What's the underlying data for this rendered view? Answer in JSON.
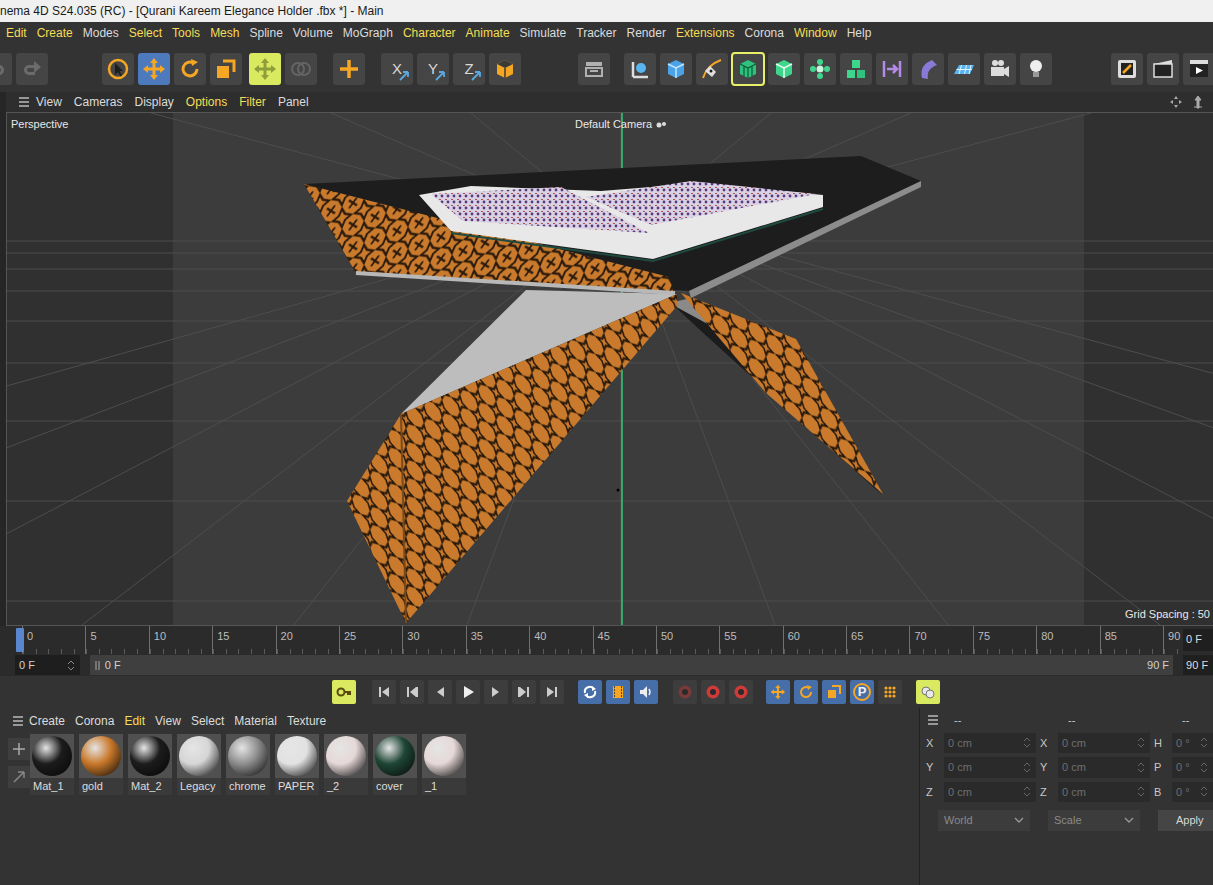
{
  "window": {
    "title": "nema 4D S24.035 (RC) - [Qurani Kareem Elegance Holder .fbx *] - Main"
  },
  "menu_bar": [
    {
      "label": "Edit",
      "highlighted": true
    },
    {
      "label": "Create",
      "highlighted": true
    },
    {
      "label": "Modes",
      "highlighted": false
    },
    {
      "label": "Select",
      "highlighted": true
    },
    {
      "label": "Tools",
      "highlighted": true
    },
    {
      "label": "Mesh",
      "highlighted": true
    },
    {
      "label": "Spline",
      "highlighted": false
    },
    {
      "label": "Volume",
      "highlighted": false
    },
    {
      "label": "MoGraph",
      "highlighted": false
    },
    {
      "label": "Character",
      "highlighted": true
    },
    {
      "label": "Animate",
      "highlighted": true
    },
    {
      "label": "Simulate",
      "highlighted": false
    },
    {
      "label": "Tracker",
      "highlighted": false
    },
    {
      "label": "Render",
      "highlighted": false
    },
    {
      "label": "Extensions",
      "highlighted": true
    },
    {
      "label": "Corona",
      "highlighted": false
    },
    {
      "label": "Window",
      "highlighted": true
    },
    {
      "label": "Help",
      "highlighted": false
    }
  ],
  "toolbar": {
    "tools": [
      {
        "active": false,
        "disabled": true
      },
      {
        "active": false,
        "disabled": true
      },
      {
        "active": false,
        "disabled": false
      },
      {
        "active": true,
        "disabled": false
      },
      {
        "active": false,
        "disabled": false
      },
      {
        "active": false,
        "disabled": false
      },
      {
        "active": true,
        "disabled": false
      },
      {
        "active": false,
        "disabled": true
      },
      {
        "active": false,
        "disabled": false
      },
      {
        "label": "X",
        "active": false,
        "disabled": false
      },
      {
        "label": "Y",
        "active": false,
        "disabled": false
      },
      {
        "label": "Z",
        "active": false,
        "disabled": false
      },
      {
        "active": false,
        "disabled": false
      },
      {
        "active": false,
        "disabled": false
      },
      {
        "active": false,
        "disabled": false
      },
      {
        "active": false,
        "disabled": false
      },
      {
        "active": false,
        "disabled": false
      },
      {
        "active": true,
        "disabled": false
      },
      {
        "active": false,
        "disabled": false
      },
      {
        "active": false,
        "disabled": false
      },
      {
        "active": false,
        "disabled": false
      },
      {
        "active": false,
        "disabled": false
      },
      {
        "active": false,
        "disabled": false
      },
      {
        "active": false,
        "disabled": false
      },
      {
        "active": false,
        "disabled": false
      },
      {
        "active": false,
        "disabled": false
      },
      {
        "active": false,
        "disabled": false
      },
      {
        "active": false,
        "disabled": false
      },
      {
        "active": false,
        "disabled": false
      }
    ]
  },
  "viewport": {
    "menu": [
      {
        "label": "View",
        "highlighted": false
      },
      {
        "label": "Cameras",
        "highlighted": false
      },
      {
        "label": "Display",
        "highlighted": false
      },
      {
        "label": "Options",
        "highlighted": true
      },
      {
        "label": "Filter",
        "highlighted": true
      },
      {
        "label": "Panel",
        "highlighted": false
      }
    ],
    "view_name": "Perspective",
    "camera": "Default Camera",
    "grid_spacing": "Grid Spacing : 50"
  },
  "timeline": {
    "ticks": [
      "0",
      "5",
      "10",
      "15",
      "20",
      "25",
      "30",
      "35",
      "40",
      "45",
      "50",
      "55",
      "60",
      "65",
      "70",
      "75",
      "80",
      "85",
      "90"
    ],
    "playhead_level": 0,
    "current_frame": "0 F",
    "start_field": "0 F",
    "range_start": "0 F",
    "range_end": "90 F",
    "end_field": "90 F"
  },
  "transport": {
    "key_mode": {
      "active": true
    },
    "controls": [
      {
        "active": false
      },
      {
        "active": false
      },
      {
        "active": false
      },
      {
        "active": false
      },
      {
        "active": false
      },
      {
        "active": false
      },
      {
        "active": false
      }
    ],
    "modes": [
      {
        "active": true
      },
      {
        "active": true
      },
      {
        "active": true
      }
    ],
    "record": [
      {
        "active": false
      },
      {
        "active": true
      },
      {
        "active": true
      }
    ],
    "filters": [
      {
        "active": true
      },
      {
        "active": true
      },
      {
        "active": true
      },
      {
        "label": "P",
        "active": true
      },
      {
        "active": false
      }
    ],
    "overlay": {
      "active": true
    }
  },
  "materials": {
    "menu": [
      {
        "label": "Create",
        "highlighted": false
      },
      {
        "label": "Corona",
        "highlighted": false
      },
      {
        "label": "Edit",
        "highlighted": true
      },
      {
        "label": "View",
        "highlighted": false
      },
      {
        "label": "Select",
        "highlighted": false
      },
      {
        "label": "Material",
        "highlighted": false
      },
      {
        "label": "Texture",
        "highlighted": false
      }
    ],
    "items": [
      {
        "name": "Mat_1",
        "color": "#1c1c1c"
      },
      {
        "name": "gold",
        "color": "#c9782a"
      },
      {
        "name": "Mat_2",
        "color": "#1c1c1c"
      },
      {
        "name": "Legacy",
        "color": "#d6d6d6"
      },
      {
        "name": "chrome",
        "color": "#8e8e8e"
      },
      {
        "name": "PAPER",
        "color": "#e2e2e2"
      },
      {
        "name": "_2",
        "color": "#e6d8d8"
      },
      {
        "name": "cover",
        "color": "#1f4636"
      },
      {
        "name": "_1",
        "color": "#e6d8d8"
      }
    ]
  },
  "coordinates": {
    "headers": [
      "--",
      "--",
      "--"
    ],
    "rows": [
      {
        "pos_axis": "X",
        "position": "0 cm",
        "size_axis": "X",
        "size": "0 cm",
        "rot_axis": "H",
        "rotation": "0 °"
      },
      {
        "pos_axis": "Y",
        "position": "0 cm",
        "size_axis": "Y",
        "size": "0 cm",
        "rot_axis": "P",
        "rotation": "0 °"
      },
      {
        "pos_axis": "Z",
        "position": "0 cm",
        "size_axis": "Z",
        "size": "0 cm",
        "rot_axis": "B",
        "rotation": "0 °"
      }
    ],
    "space": "World",
    "size_mode": "Scale",
    "apply": "Apply"
  }
}
